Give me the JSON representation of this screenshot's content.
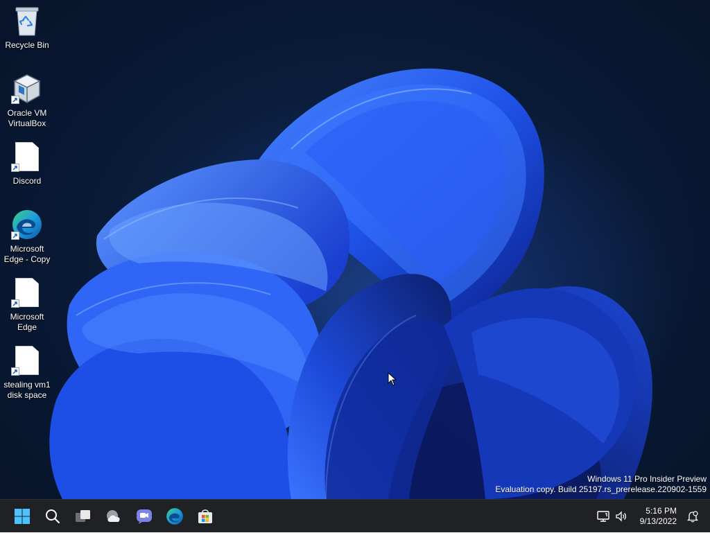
{
  "desktop": {
    "icons": [
      {
        "label": "Recycle Bin",
        "icon": "recycle-bin-icon"
      },
      {
        "label": "Oracle VM VirtualBox",
        "icon": "virtualbox-icon"
      },
      {
        "label": "Discord",
        "icon": "blank-document-icon"
      },
      {
        "label": "Microsoft Edge - Copy",
        "icon": "edge-icon"
      },
      {
        "label": "Microsoft Edge",
        "icon": "blank-document-icon"
      },
      {
        "label": "stealing vm1 disk space",
        "icon": "blank-document-icon"
      }
    ],
    "watermark": {
      "line1": "Windows 11 Pro Insider Preview",
      "line2": "Evaluation copy. Build 25197.rs_prerelease.220902-1559"
    }
  },
  "taskbar": {
    "pinned": [
      {
        "name": "start",
        "icon": "windows-start-icon"
      },
      {
        "name": "search",
        "icon": "search-icon"
      },
      {
        "name": "task-view",
        "icon": "task-view-icon"
      },
      {
        "name": "widgets",
        "icon": "weather-cloud-icon"
      },
      {
        "name": "chat",
        "icon": "teams-chat-icon"
      },
      {
        "name": "edge",
        "icon": "edge-icon"
      },
      {
        "name": "store",
        "icon": "microsoft-store-icon"
      }
    ],
    "tray": {
      "icons": [
        "network-icon",
        "volume-icon"
      ],
      "time": "5:16 PM",
      "date": "9/13/2022",
      "notification_icon": "notification-settings-icon"
    }
  },
  "colors": {
    "accent": "#1e5ff5",
    "taskbar": "#1f2124",
    "wallpaper_dark": "#081730"
  }
}
